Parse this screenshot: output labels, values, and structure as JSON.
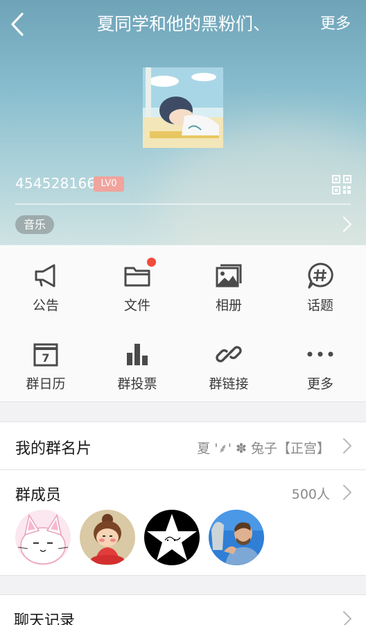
{
  "header": {
    "title": "夏同学和他的黑粉们、",
    "more_label": "更多"
  },
  "group": {
    "id": "454528166",
    "level": "LV0",
    "tag": "音乐"
  },
  "features": [
    {
      "label": "公告",
      "icon": "megaphone-icon"
    },
    {
      "label": "文件",
      "icon": "folder-icon"
    },
    {
      "label": "相册",
      "icon": "photo-album-icon"
    },
    {
      "label": "话题",
      "icon": "topic-hash-icon"
    },
    {
      "label": "群日历",
      "icon": "calendar-icon"
    },
    {
      "label": "群投票",
      "icon": "bar-chart-icon"
    },
    {
      "label": "群链接",
      "icon": "link-icon"
    },
    {
      "label": "更多",
      "icon": "more-dots-icon"
    }
  ],
  "my_card": {
    "title": "我的群名片",
    "value": "夏 '⸙' ✽ 兔子【正宫】"
  },
  "members": {
    "title": "群成员",
    "count": "500人",
    "avatars": [
      "cat-avatar",
      "cartoon-girl-avatar",
      "star-avatar",
      "man-photo-avatar"
    ]
  },
  "chat_history": {
    "title": "聊天记录"
  },
  "colors": {
    "badge_dot": "#f24b3b",
    "level_badge": "#f0a49d",
    "icon_gray": "#4a4a4a"
  }
}
